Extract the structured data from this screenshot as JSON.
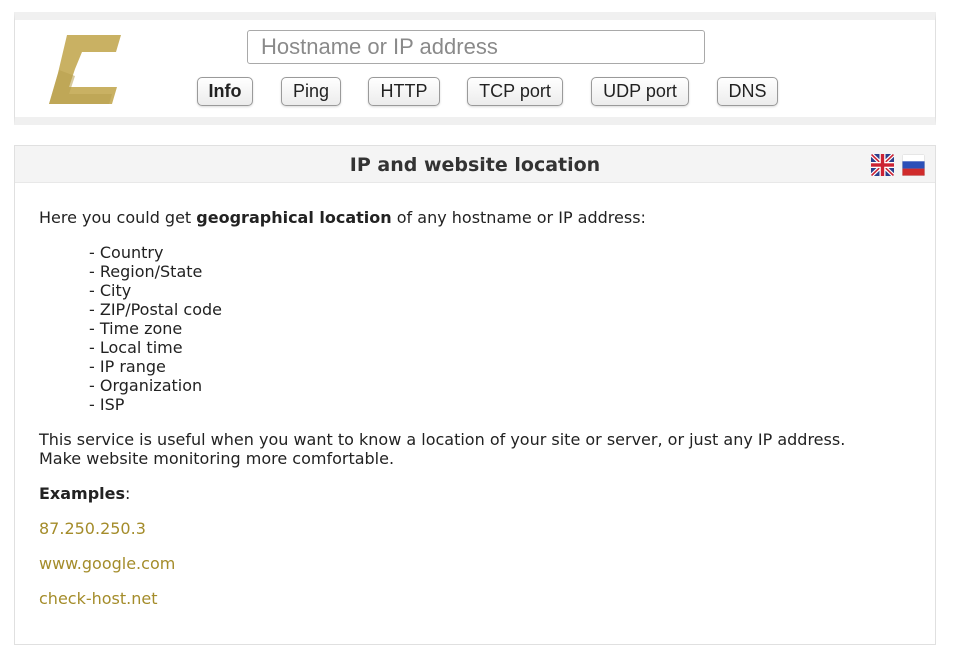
{
  "search": {
    "placeholder": "Hostname or IP address",
    "value": ""
  },
  "tabs": [
    {
      "label": "Info",
      "active": true
    },
    {
      "label": "Ping",
      "active": false
    },
    {
      "label": "HTTP",
      "active": false
    },
    {
      "label": "TCP port",
      "active": false
    },
    {
      "label": "UDP port",
      "active": false
    },
    {
      "label": "DNS",
      "active": false
    }
  ],
  "main": {
    "title": "IP and website location",
    "intro_prefix": "Here you could get ",
    "intro_bold": "geographical location",
    "intro_suffix": " of any hostname or IP address:",
    "features": [
      "- Country",
      "- Region/State",
      "- City",
      "- ZIP/Postal code",
      "- Time zone",
      "- Local time",
      "- IP range",
      "- Organization",
      "- ISP"
    ],
    "description_line1": "This service is useful when you want to know a location of your site or server, or just any IP address.",
    "description_line2": "Make website monitoring more comfortable.",
    "examples_label": "Examples",
    "examples_colon": ":",
    "examples": [
      "87.250.250.3",
      "www.google.com",
      "check-host.net"
    ]
  },
  "colors": {
    "brand": "#c9b163",
    "link": "#a48c2a"
  },
  "icons": {
    "logo": "check-host-logo",
    "flag_en": "uk-flag-icon",
    "flag_ru": "russia-flag-icon"
  }
}
